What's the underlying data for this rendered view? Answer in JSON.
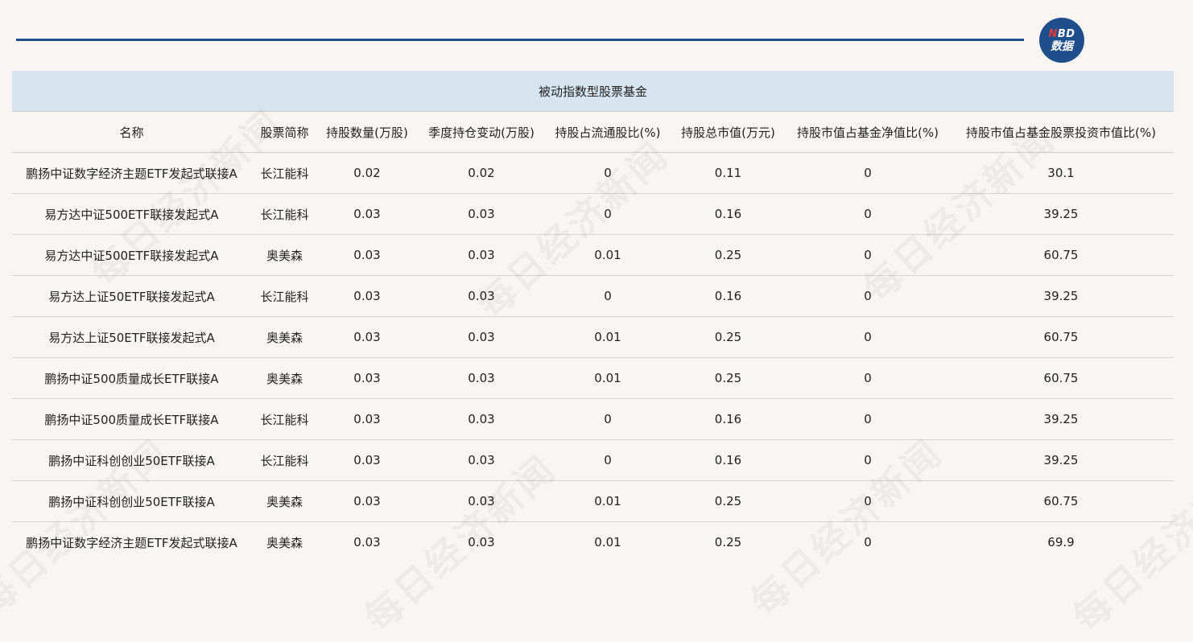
{
  "brand": {
    "logo_top": "NBD",
    "logo_bottom": "数据",
    "accent_color": "#1f4e8c"
  },
  "watermark_text": "每日经济新闻",
  "table": {
    "title": "被动指数型股票基金",
    "headers": [
      "名称",
      "股票简称",
      "持股数量(万股)",
      "季度持仓变动(万股)",
      "持股占流通股比(%)",
      "持股总市值(万元)",
      "持股市值占基金净值比(%)",
      "持股市值占基金股票投资市值比(%)"
    ],
    "rows": [
      [
        "鹏扬中证数字经济主题ETF发起式联接A",
        "长江能科",
        "0.02",
        "0.02",
        "0",
        "0.11",
        "0",
        "30.1"
      ],
      [
        "易方达中证500ETF联接发起式A",
        "长江能科",
        "0.03",
        "0.03",
        "0",
        "0.16",
        "0",
        "39.25"
      ],
      [
        "易方达中证500ETF联接发起式A",
        "奥美森",
        "0.03",
        "0.03",
        "0.01",
        "0.25",
        "0",
        "60.75"
      ],
      [
        "易方达上证50ETF联接发起式A",
        "长江能科",
        "0.03",
        "0.03",
        "0",
        "0.16",
        "0",
        "39.25"
      ],
      [
        "易方达上证50ETF联接发起式A",
        "奥美森",
        "0.03",
        "0.03",
        "0.01",
        "0.25",
        "0",
        "60.75"
      ],
      [
        "鹏扬中证500质量成长ETF联接A",
        "奥美森",
        "0.03",
        "0.03",
        "0.01",
        "0.25",
        "0",
        "60.75"
      ],
      [
        "鹏扬中证500质量成长ETF联接A",
        "长江能科",
        "0.03",
        "0.03",
        "0",
        "0.16",
        "0",
        "39.25"
      ],
      [
        "鹏扬中证科创创业50ETF联接A",
        "长江能科",
        "0.03",
        "0.03",
        "0",
        "0.16",
        "0",
        "39.25"
      ],
      [
        "鹏扬中证科创创业50ETF联接A",
        "奥美森",
        "0.03",
        "0.03",
        "0.01",
        "0.25",
        "0",
        "60.75"
      ],
      [
        "鹏扬中证数字经济主题ETF发起式联接A",
        "奥美森",
        "0.03",
        "0.03",
        "0.01",
        "0.25",
        "0",
        "69.9"
      ]
    ]
  }
}
